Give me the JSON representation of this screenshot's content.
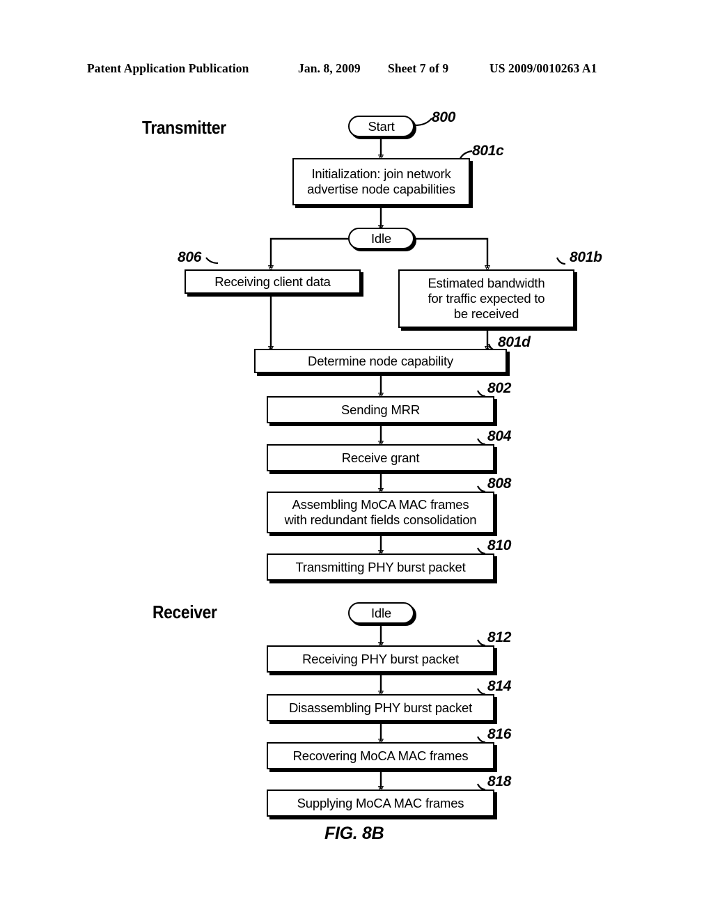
{
  "header": {
    "publication": "Patent Application Publication",
    "date": "Jan. 8, 2009",
    "sheet": "Sheet 7 of 9",
    "patent_number": "US 2009/0010263 A1"
  },
  "figure": {
    "caption": "FIG. 8B",
    "sections": {
      "transmitter_title": "Transmitter",
      "receiver_title": "Receiver"
    },
    "nodes": {
      "start": "Start",
      "idle_tx": "Idle",
      "idle_rx": "Idle",
      "initialization": "Initialization: join network\nadvertise node capabilities",
      "receiving_client_data": "Receiving client data",
      "estimated_bandwidth": "Estimated bandwidth\nfor traffic expected to\nbe received",
      "determine_node_capability": "Determine node capability",
      "sending_mrr": "Sending MRR",
      "receive_grant": "Receive grant",
      "assembling_frames": "Assembling MoCA MAC frames\nwith redundant fields consolidation",
      "transmitting_burst": "Transmitting PHY burst packet",
      "receiving_burst": "Receiving  PHY burst packet",
      "disassembling_burst": "Disassembling PHY burst packet",
      "recovering_frames": "Recovering MoCA MAC frames",
      "supplying_frames": "Supplying MoCA MAC frames"
    },
    "reference_numerals": {
      "start": "800",
      "initialization": "801c",
      "receiving_client_data": "806",
      "estimated_bandwidth": "801b",
      "determine_node_capability": "801d",
      "sending_mrr": "802",
      "receive_grant": "804",
      "assembling_frames": "808",
      "transmitting_burst": "810",
      "receiving_burst": "812",
      "disassembling_burst": "814",
      "recovering_frames": "816",
      "supplying_frames": "818"
    }
  }
}
